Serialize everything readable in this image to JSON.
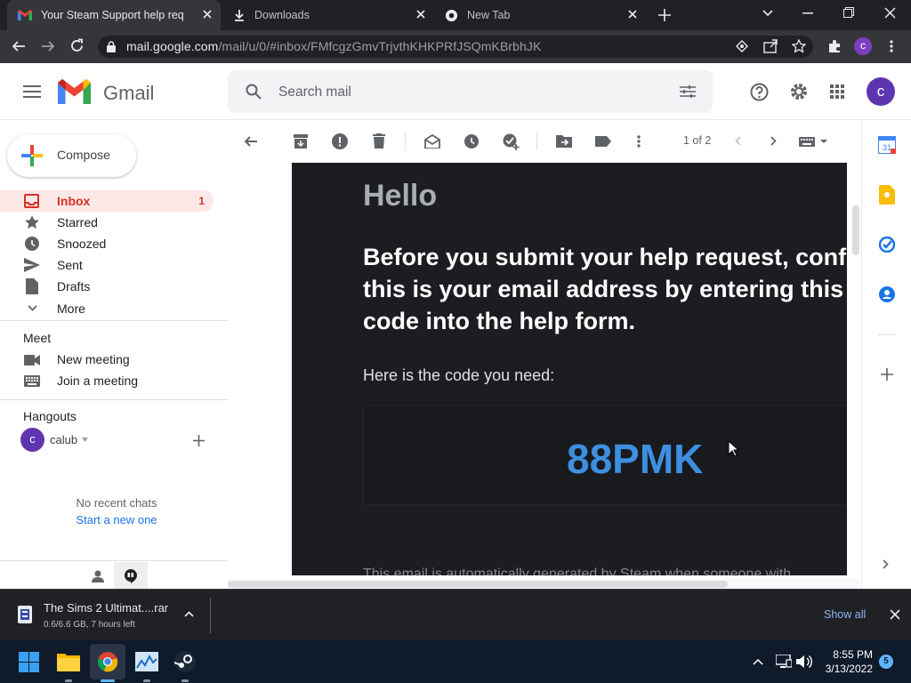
{
  "browser": {
    "tabs": [
      {
        "title": "Your Steam Support help request",
        "icon": "gmail-icon",
        "active": true
      },
      {
        "title": "Downloads",
        "icon": "download-icon",
        "active": false
      },
      {
        "title": "New Tab",
        "icon": "chrome-icon",
        "active": false
      }
    ],
    "url_host": "mail.google.com",
    "url_path": "/mail/u/0/#inbox/FMfcgzGmvTrjvthKHKPRfJSQmKBrbhJK",
    "profile_initial": "c"
  },
  "gmail": {
    "product_name": "Gmail",
    "search_placeholder": "Search mail",
    "profile_initial": "c",
    "compose_label": "Compose",
    "nav": [
      {
        "label": "Inbox",
        "count": "1",
        "icon": "inbox-icon"
      },
      {
        "label": "Starred",
        "count": "",
        "icon": "star-icon"
      },
      {
        "label": "Snoozed",
        "count": "",
        "icon": "clock-icon"
      },
      {
        "label": "Sent",
        "count": "",
        "icon": "send-icon"
      },
      {
        "label": "Drafts",
        "count": "",
        "icon": "draft-icon"
      },
      {
        "label": "More",
        "count": "",
        "icon": "chevron-down-icon"
      }
    ],
    "meet": {
      "heading": "Meet",
      "items": [
        {
          "label": "New meeting",
          "icon": "video-icon"
        },
        {
          "label": "Join a meeting",
          "icon": "keyboard-icon"
        }
      ]
    },
    "hangouts": {
      "heading": "Hangouts",
      "user": "calub",
      "user_initial": "c",
      "empty_text": "No recent chats",
      "start_link": "Start a new one"
    },
    "toolbar": {
      "pagination": "1 of 2"
    },
    "email": {
      "greeting": "Hello",
      "intro_lines": [
        "Before you submit your help request, confirm",
        "this is your email address by entering this",
        "code into the help form."
      ],
      "code_label": "Here is the code you need:",
      "code": "88PMK",
      "footer": "This email is automatically generated by Steam when someone with"
    },
    "side_panel_icons": [
      "calendar-icon",
      "keep-icon",
      "tasks-icon",
      "contacts-icon",
      "add-icon"
    ]
  },
  "download": {
    "filename": "The Sims 2 Ultimat....rar",
    "status": "0.6/6.6 GB, 7 hours left",
    "show_all": "Show all"
  },
  "taskbar": {
    "time": "8:55 PM",
    "date": "3/13/2022",
    "notifications": "5"
  }
}
